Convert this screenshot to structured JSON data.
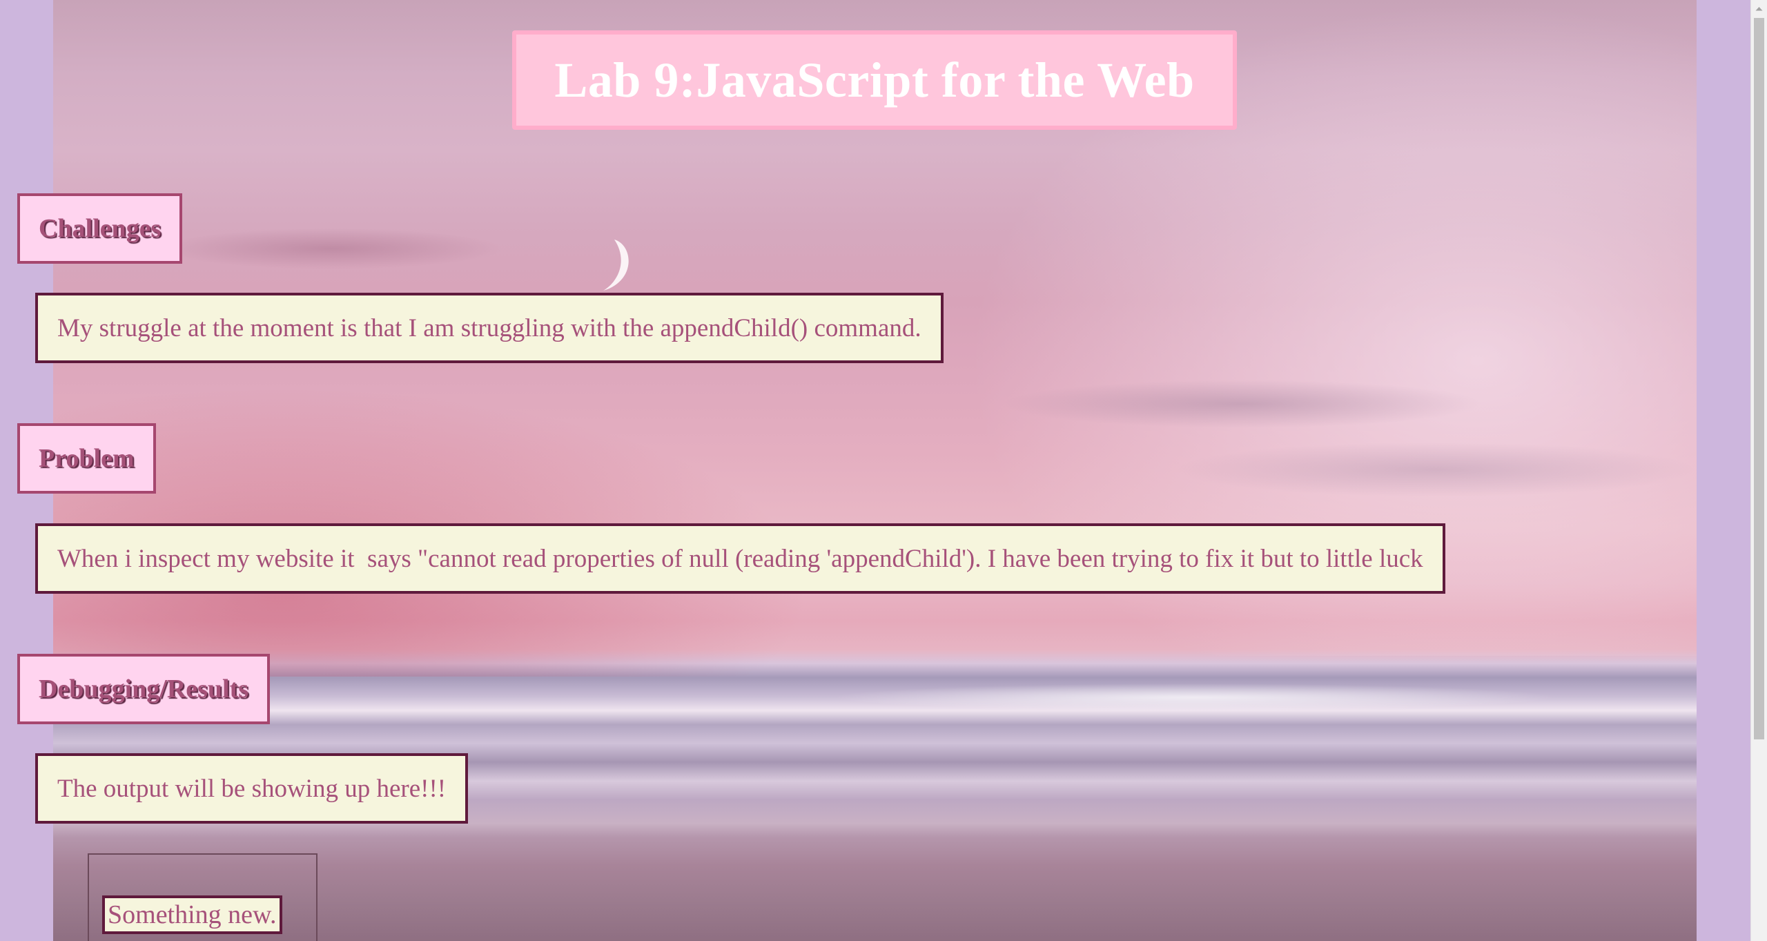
{
  "page": {
    "title": "Lab 9:JavaScript for the Web"
  },
  "sections": [
    {
      "heading": "Challenges",
      "text": "My struggle at the moment is that I am struggling with the appendChild() command."
    },
    {
      "heading": "Problem",
      "text": "When i inspect my website it  says \"cannot read properties of null (reading 'appendChild'). I have been trying to fix it but to little luck"
    },
    {
      "heading": "Debugging/Results",
      "text": "The output will be showing up here!!!"
    }
  ],
  "output": {
    "items": [
      "Something new."
    ]
  },
  "icons": {
    "scroll_up": "scroll-up-arrow-icon",
    "moon": "crescent-moon-icon"
  },
  "colors": {
    "page_background": "#cdb6dd",
    "title_fill": "#ffc6dc",
    "title_border": "#ffadcb",
    "heading_fill": "#ffd4ef",
    "heading_border": "#a6476f",
    "heading_text": "#a55178",
    "text_fill": "#f6f5dd",
    "text_border": "#5f1a3c",
    "text_color": "#a6517a"
  }
}
